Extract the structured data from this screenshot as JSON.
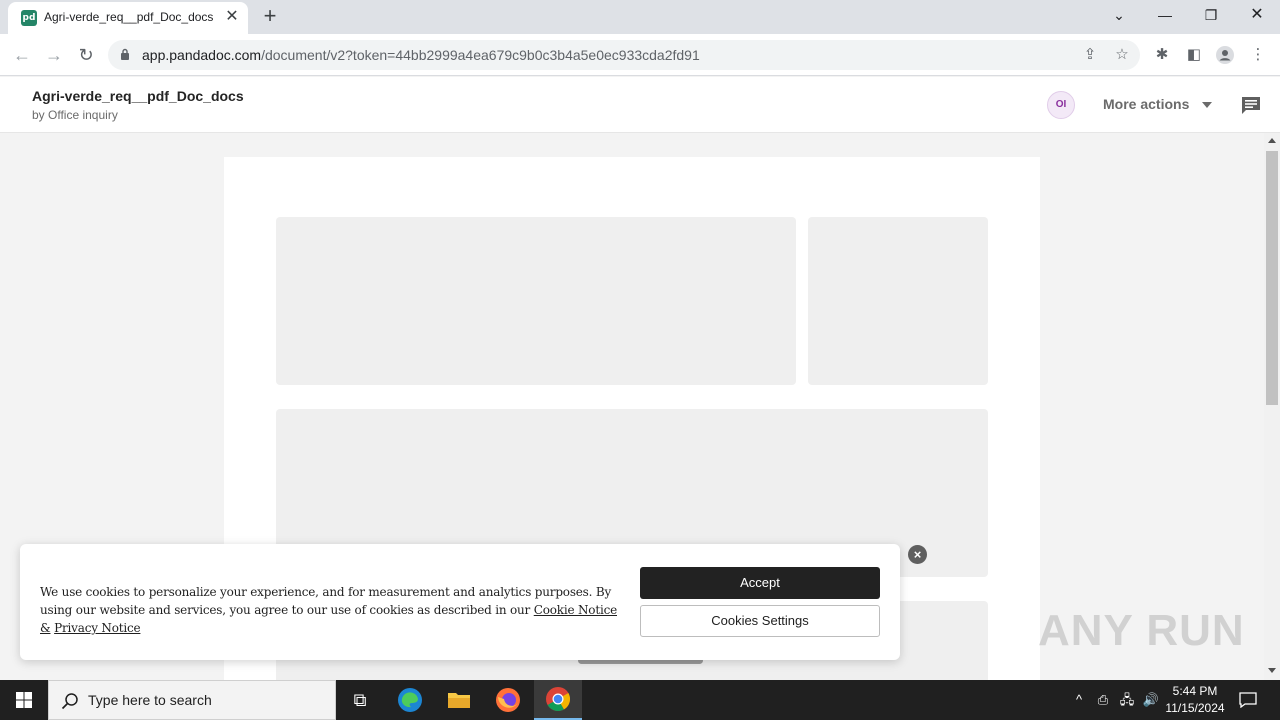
{
  "browser": {
    "tab_title": "Agri-verde_req__pdf_Doc_docs",
    "tab_favicon": "pd",
    "url_host": "app.pandadoc.com",
    "url_path": "/document/v2?token=44bb2999a4ea679c9b0c3b4a5e0ec933cda2fd91"
  },
  "header": {
    "title": "Agri-verde_req__pdf_Doc_docs",
    "subtitle": "by Office inquiry",
    "avatar_initials": "OI",
    "more_actions": "More actions"
  },
  "cookie": {
    "text_before": "We use cookies to personalize your experience, and for measurement and analytics purposes. By using our website and services, you agree to our use of cookies as described in our",
    "link1": "Cookie Notice &",
    "link2": "Privacy Notice",
    "accept": "Accept",
    "settings": "Cookies Settings"
  },
  "watermark": "ANY RUN",
  "taskbar": {
    "search_placeholder": "Type here to search",
    "time": "5:44 PM",
    "date": "11/15/2024"
  },
  "colors": {
    "brand_green": "#248567",
    "accept_button": "#222222",
    "placeholder_gray": "#efefef"
  }
}
